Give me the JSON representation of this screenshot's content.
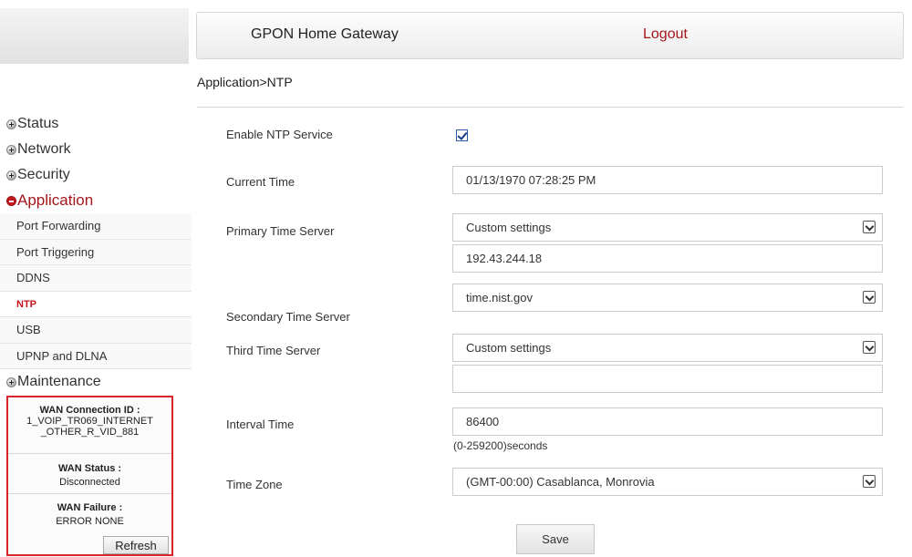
{
  "header": {
    "title": "GPON Home Gateway",
    "logout": "Logout"
  },
  "breadcrumb": "Application>NTP",
  "sidebar": {
    "groups": [
      "Status",
      "Network",
      "Security",
      "Application",
      "Maintenance"
    ],
    "active_group": "Application",
    "sub_items": [
      "Port Forwarding",
      "Port Triggering",
      "DDNS",
      "NTP",
      "USB",
      "UPNP and DLNA"
    ],
    "current_item": "NTP"
  },
  "wan": {
    "connection_id_label": "WAN Connection ID :",
    "connection_id_value": "1_VOIP_TR069_INTERNET _OTHER_R_VID_881",
    "status_label": "WAN Status :",
    "status_value": "Disconnected",
    "failure_label": "WAN Failure :",
    "failure_value": "ERROR NONE",
    "refresh": "Refresh"
  },
  "form": {
    "enable_label": "Enable NTP Service",
    "enable_checked": true,
    "current_time_label": "Current Time",
    "current_time_value": "01/13/1970 07:28:25 PM",
    "primary_label": "Primary Time Server",
    "primary_select": "Custom settings",
    "primary_custom": "192.43.244.18",
    "secondary_label": "Secondary Time Server",
    "secondary_select": "time.nist.gov",
    "third_label": "Third Time Server",
    "third_select": "Custom settings",
    "third_custom": "",
    "interval_label": "Interval Time",
    "interval_value": "86400",
    "interval_hint": "(0-259200)seconds",
    "timezone_label": "Time Zone",
    "timezone_select": "(GMT-00:00) Casablanca, Monrovia",
    "save": "Save"
  },
  "colors": {
    "accent_red": "#c4161c",
    "logout_red": "#a4161a",
    "wan_border": "#d9242b"
  }
}
